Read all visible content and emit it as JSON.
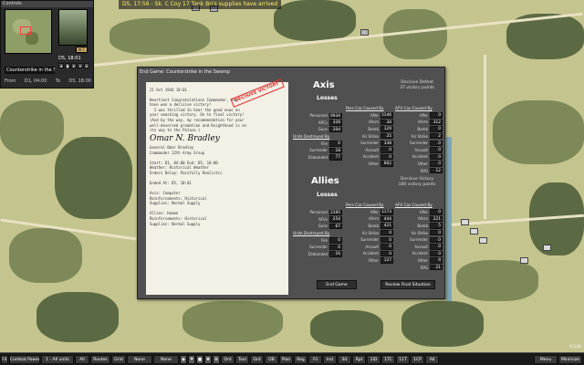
{
  "top_message": "D5, 17:56 - Sk. C Coy 17 Tank Bn's supplies have arrived",
  "minimap": {
    "caption": "Controls",
    "weather_label": "W.T.",
    "current_time": "D5, 18:01",
    "scenario_name": "Counterstrike in the Swamp",
    "from_label": "From",
    "from_time": "D1, 04:00",
    "to_label": "To",
    "to_time": "D5, 18:00"
  },
  "dialog": {
    "title": "End Game: Counterstrike in the Swamp",
    "letter": {
      "date": "21 Oct 1944 18:01",
      "stamp": "DECISIVE VICTORY",
      "body": [
        "Heartiest Congratulations Commander, you",
        "have won a decisive victory!",
        "  I was thrilled to hear the good news on",
        "your smashing victory. On to final victory!",
        "(And by the way, my recommendation for your",
        "well-deserved promotion and Knighthood is on",
        "its way to the Palace.)"
      ],
      "signature": "Omar N. Bradley",
      "signer": [
        "General Omar Bradley",
        "Commander 12th Army Group"
      ],
      "details": [
        "Start: D1, 04:00 End: D5, 18:00",
        "Weather: Historical Weather",
        "Orders Delay: Painfully Realistic",
        "",
        "Ended At: D5, 18:01",
        "",
        "Axis: Computer",
        "Reinforcements: Historical",
        "Supplies: Normal Supply",
        "",
        "Allies: Human",
        "Reinforcements: Historical",
        "Supplies: Normal Supply"
      ]
    },
    "axis": {
      "name": "Axis",
      "losses_label": "Losses",
      "result": [
        "Decisive Defeat",
        "37 victory points"
      ],
      "losses": [
        {
          "label": "Personnel",
          "value": "6934"
        },
        {
          "label": "APCs",
          "value": "328"
        },
        {
          "label": "Guns",
          "value": "204"
        }
      ],
      "units_destroyed_header": "Units Destroyed By",
      "destroyed": [
        {
          "label": "Fire",
          "value": "0"
        },
        {
          "label": "Surrender",
          "value": "18"
        },
        {
          "label": "Disbanded",
          "value": "77"
        }
      ],
      "pers_header": "Pers Cas Caused By",
      "pers": [
        {
          "label": "APer",
          "value": "5146"
        },
        {
          "label": "AArm",
          "value": "34"
        },
        {
          "label": "Bomb",
          "value": "129"
        },
        {
          "label": "Air Strike",
          "value": "25"
        },
        {
          "label": "Surrender",
          "value": "338"
        },
        {
          "label": "Assault",
          "value": "0"
        },
        {
          "label": "Accident",
          "value": "0"
        },
        {
          "label": "Other",
          "value": "662"
        }
      ],
      "afv_header": "AFV Cas Caused By",
      "afv": [
        {
          "label": "APer",
          "value": "0"
        },
        {
          "label": "AArm",
          "value": "312"
        },
        {
          "label": "Bomb",
          "value": "0"
        },
        {
          "label": "Air Strike",
          "value": "2"
        },
        {
          "label": "Surrender",
          "value": "0"
        },
        {
          "label": "Assault",
          "value": "0"
        },
        {
          "label": "Accident",
          "value": "0"
        },
        {
          "label": "Other",
          "value": "0"
        },
        {
          "label": "RPG",
          "value": "12"
        }
      ]
    },
    "allies": {
      "name": "Allies",
      "losses_label": "Losses",
      "result": [
        "Decisive Victory",
        "180 victory points"
      ],
      "losses": [
        {
          "label": "Personnel",
          "value": "2195"
        },
        {
          "label": "AFVs",
          "value": "254"
        },
        {
          "label": "Guns",
          "value": "67"
        }
      ],
      "units_destroyed_header": "Units Destroyed By",
      "destroyed": [
        {
          "label": "Fire",
          "value": "0"
        },
        {
          "label": "Surrender",
          "value": "0"
        },
        {
          "label": "Disbanded",
          "value": "16"
        }
      ],
      "pers_header": "Pers Cas Caused By",
      "pers": [
        {
          "label": "APer",
          "value": "1173"
        },
        {
          "label": "AArm",
          "value": "444"
        },
        {
          "label": "Bomb",
          "value": "421"
        },
        {
          "label": "Air Strike",
          "value": "0"
        },
        {
          "label": "Surrender",
          "value": "0"
        },
        {
          "label": "Assault",
          "value": "0"
        },
        {
          "label": "Accident",
          "value": "0"
        },
        {
          "label": "Other",
          "value": "127"
        }
      ],
      "afv_header": "AFV Cas Caused By",
      "afv": [
        {
          "label": "APer",
          "value": "0"
        },
        {
          "label": "AArm",
          "value": "221"
        },
        {
          "label": "Bomb",
          "value": "5"
        },
        {
          "label": "Air Strike",
          "value": "0"
        },
        {
          "label": "Surrender",
          "value": "0"
        },
        {
          "label": "Assault",
          "value": "0"
        },
        {
          "label": "Accident",
          "value": "0"
        },
        {
          "label": "Other",
          "value": "9"
        },
        {
          "label": "RPG",
          "value": "21"
        }
      ]
    },
    "end_game_button": "End Game",
    "review_button": "Review Final Situation"
  },
  "bottom_bar": {
    "f4_label": "F4",
    "combat_power": "Combat Power",
    "filter": "1 - All units",
    "all": "All",
    "routes": "Routes",
    "grid": "Grid",
    "none1": "None",
    "none2": "None",
    "buttons": [
      "Ord",
      "Tool",
      "Grd",
      "OB",
      "Plan",
      "Reg",
      "Fil",
      "Ind",
      "Sit",
      "Rpt",
      "1ID",
      "1TC",
      "11T",
      "1CP",
      "All"
    ],
    "menu": "Menu",
    "minimize": "Minimize"
  },
  "coord_readout": "5,126"
}
